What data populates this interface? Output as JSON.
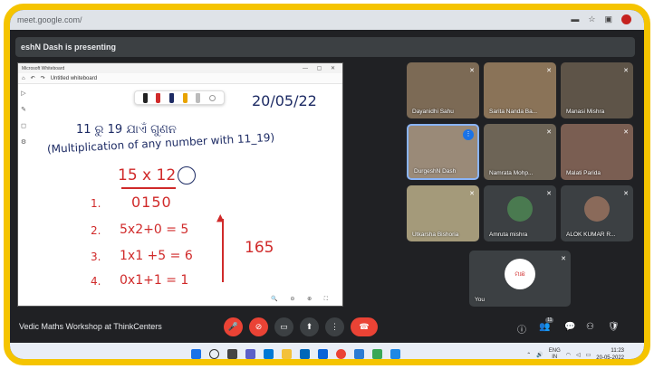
{
  "browser": {
    "url": "meet.google.com/"
  },
  "presenting_banner": "eshN Dash is presenting",
  "whiteboard": {
    "app_title": "Microsoft Whiteboard",
    "board_name": "Untitled whiteboard",
    "date": "20/05/22",
    "line1": "11 ରୁ 19 ଯାଏଁ ଗୁଣନ",
    "line2": "(Multiplication of any number with 11_19)",
    "problem": "15 x 12",
    "working": "0150",
    "steps": [
      {
        "num": "1.",
        "text": ""
      },
      {
        "num": "2.",
        "text": "5x2+0 = 5"
      },
      {
        "num": "3.",
        "text": "1x1 +5 = 6"
      },
      {
        "num": "4.",
        "text": "0x1+1 = 1"
      }
    ],
    "answer": "165"
  },
  "participants": [
    {
      "name": "Dayanidhi Sahu",
      "mic": "off"
    },
    {
      "name": "Sarita Nanda Ba...",
      "mic": "off"
    },
    {
      "name": "Manasi Mishra",
      "mic": "off"
    },
    {
      "name": "DurgeshN Dash",
      "mic": "on",
      "speaking": true
    },
    {
      "name": "Namrata Mohp...",
      "mic": "off"
    },
    {
      "name": "Malati Parida",
      "mic": "off"
    },
    {
      "name": "Utkarsha Bishoria",
      "mic": "off"
    },
    {
      "name": "Amruta mishra",
      "mic": "off"
    },
    {
      "name": "ALOK KUMAR R...",
      "mic": "off"
    },
    {
      "name": "You",
      "mic": "off"
    }
  ],
  "you_avatar_text": "ମାଛ",
  "meeting_title": "Vedic Maths Workshop at ThinkCenters",
  "participant_count": "11",
  "taskbar": {
    "lang_top": "ENG",
    "lang_bottom": "IN",
    "time": "11:23",
    "date": "20-05-2022"
  },
  "colors": {
    "frame": "#f5c400",
    "meet_bg": "#202124",
    "red": "#ea4335",
    "ink_red": "#d02a2a",
    "ink_dark": "#1d2b64"
  }
}
